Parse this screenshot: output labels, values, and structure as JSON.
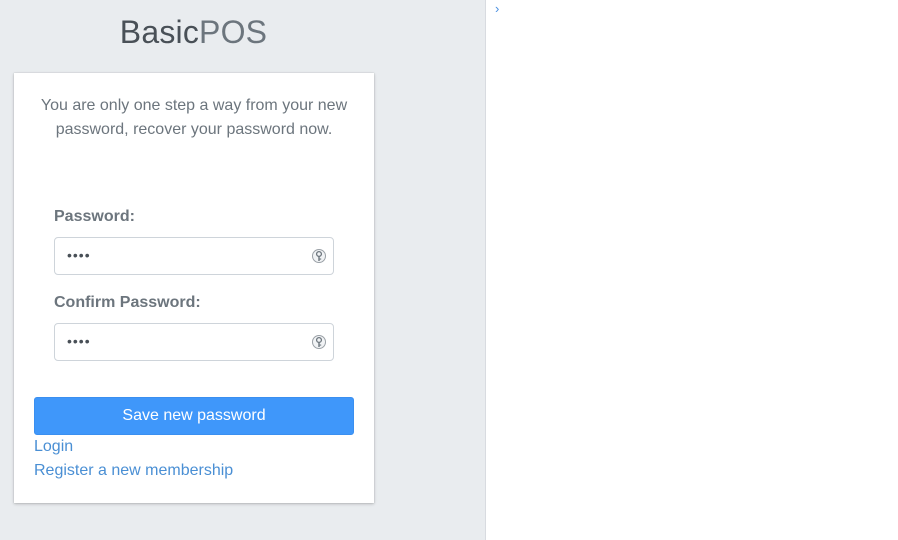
{
  "brand": {
    "bold": "Basic",
    "light": "POS"
  },
  "card": {
    "message": "You are only one step a way from your new password, recover your password now.",
    "password_label": "Password:",
    "password_value": "••••",
    "confirm_label": "Confirm Password:",
    "confirm_value": "••••",
    "save_label": "Save new password",
    "login_link": "Login",
    "register_link": "Register a new membership"
  },
  "console": {
    "prompt_glyph": "›"
  },
  "colors": {
    "accent": "#3f97fa",
    "link": "#4a8fd4",
    "background": "#e9ecef"
  },
  "icons": [
    "key-icon",
    "chevron-right-icon"
  ]
}
